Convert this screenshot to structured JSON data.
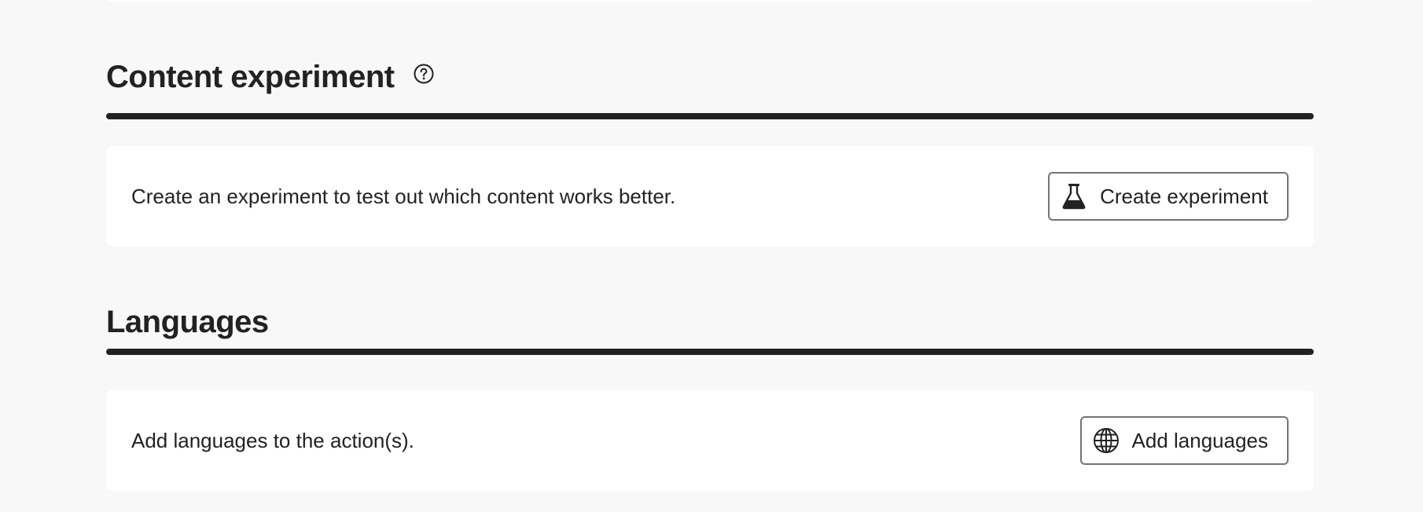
{
  "content_experiment": {
    "title": "Content experiment",
    "help_icon": "help-circle-icon",
    "description": "Create an experiment to test out which content works better.",
    "button_label": "Create experiment",
    "button_icon": "beaker-icon"
  },
  "languages": {
    "title": "Languages",
    "description": "Add languages to the action(s).",
    "button_label": "Add languages",
    "button_icon": "globe-icon"
  },
  "colors": {
    "background": "#f8f8f8",
    "card": "#ffffff",
    "text": "#222222",
    "divider": "#222222",
    "button_border": "#747474"
  }
}
